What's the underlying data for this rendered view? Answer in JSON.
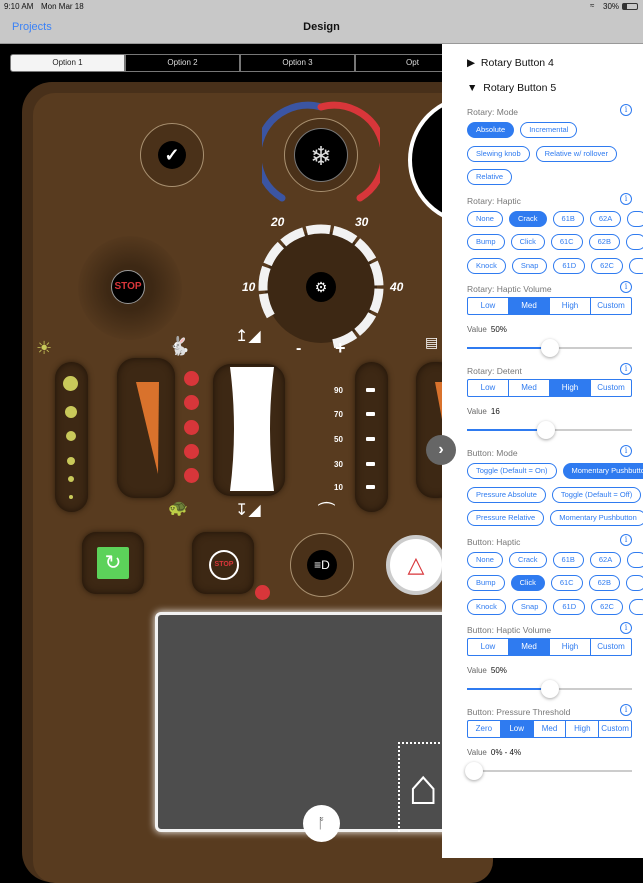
{
  "status": {
    "time": "9:10 AM",
    "date": "Mon Mar 18",
    "battery": "30%"
  },
  "nav": {
    "back": "Projects",
    "title": "Design"
  },
  "options": [
    "Option 1",
    "Option 2",
    "Option 3",
    "Opt"
  ],
  "selected_option": 0,
  "dashboard": {
    "dial_labels": [
      "10",
      "20",
      "30",
      "40"
    ],
    "minus": "-",
    "plus": "+",
    "stop_label": "STOP",
    "scale": [
      "90",
      "70",
      "50",
      "30",
      "10"
    ],
    "colors": {
      "panel": "#583b1f",
      "cold": "#3b55a3",
      "hot": "#d8363a",
      "orange": "#d9722c",
      "green": "#5cd25a"
    }
  },
  "side": {
    "accent": "#2f7bf0",
    "collapsed": "Rotary Button 4",
    "expanded": "Rotary Button 5",
    "sections": [
      {
        "label": "Rotary: Mode",
        "type": "chips",
        "rows": [
          [
            "Absolute",
            "Incremental"
          ],
          [
            "Slewing knob",
            "Relative w/ rollover"
          ],
          [
            "Relative"
          ]
        ],
        "selected": "Absolute"
      },
      {
        "label": "Rotary: Haptic",
        "type": "chips",
        "rows": [
          [
            "None",
            "Crack",
            "61B",
            "62A",
            ""
          ],
          [
            "Bump",
            "Click",
            "61C",
            "62B",
            ""
          ],
          [
            "Knock",
            "Snap",
            "61D",
            "62C",
            ""
          ]
        ],
        "selected": "Crack"
      },
      {
        "label": "Rotary: Haptic Volume",
        "type": "segment",
        "options": [
          "Low",
          "Med",
          "High",
          "Custom"
        ],
        "selected": "Med",
        "value_label": "Value",
        "value": "50%",
        "slider": 0.5
      },
      {
        "label": "Rotary: Detent",
        "type": "segment",
        "options": [
          "Low",
          "Med",
          "High",
          "Custom"
        ],
        "selected": "High",
        "value_label": "Value",
        "value": "16",
        "slider": 0.48
      },
      {
        "label": "Button: Mode",
        "type": "chips",
        "rows": [
          [
            "Toggle (Default = On)",
            "Momentary Pushbutton"
          ],
          [
            "Pressure Absolute",
            "Toggle (Default = Off)"
          ],
          [
            "Pressure Relative",
            "Momentary Pushbutton"
          ]
        ],
        "selected": "Momentary Pushbutton",
        "selected_row": 0
      },
      {
        "label": "Button: Haptic",
        "type": "chips",
        "rows": [
          [
            "None",
            "Crack",
            "61B",
            "62A",
            ""
          ],
          [
            "Bump",
            "Click",
            "61C",
            "62B",
            ""
          ],
          [
            "Knock",
            "Snap",
            "61D",
            "62C",
            ""
          ]
        ],
        "selected": "Click"
      },
      {
        "label": "Button: Haptic Volume",
        "type": "segment",
        "options": [
          "Low",
          "Med",
          "High",
          "Custom"
        ],
        "selected": "Med",
        "value_label": "Value",
        "value": "50%",
        "slider": 0.5
      },
      {
        "label": "Button: Pressure Threshold",
        "type": "segment",
        "options": [
          "Zero",
          "Low",
          "Med",
          "High",
          "Custom"
        ],
        "selected": "Low",
        "value_label": "Value",
        "value": "0% - 4%",
        "slider": 0.04
      }
    ]
  }
}
